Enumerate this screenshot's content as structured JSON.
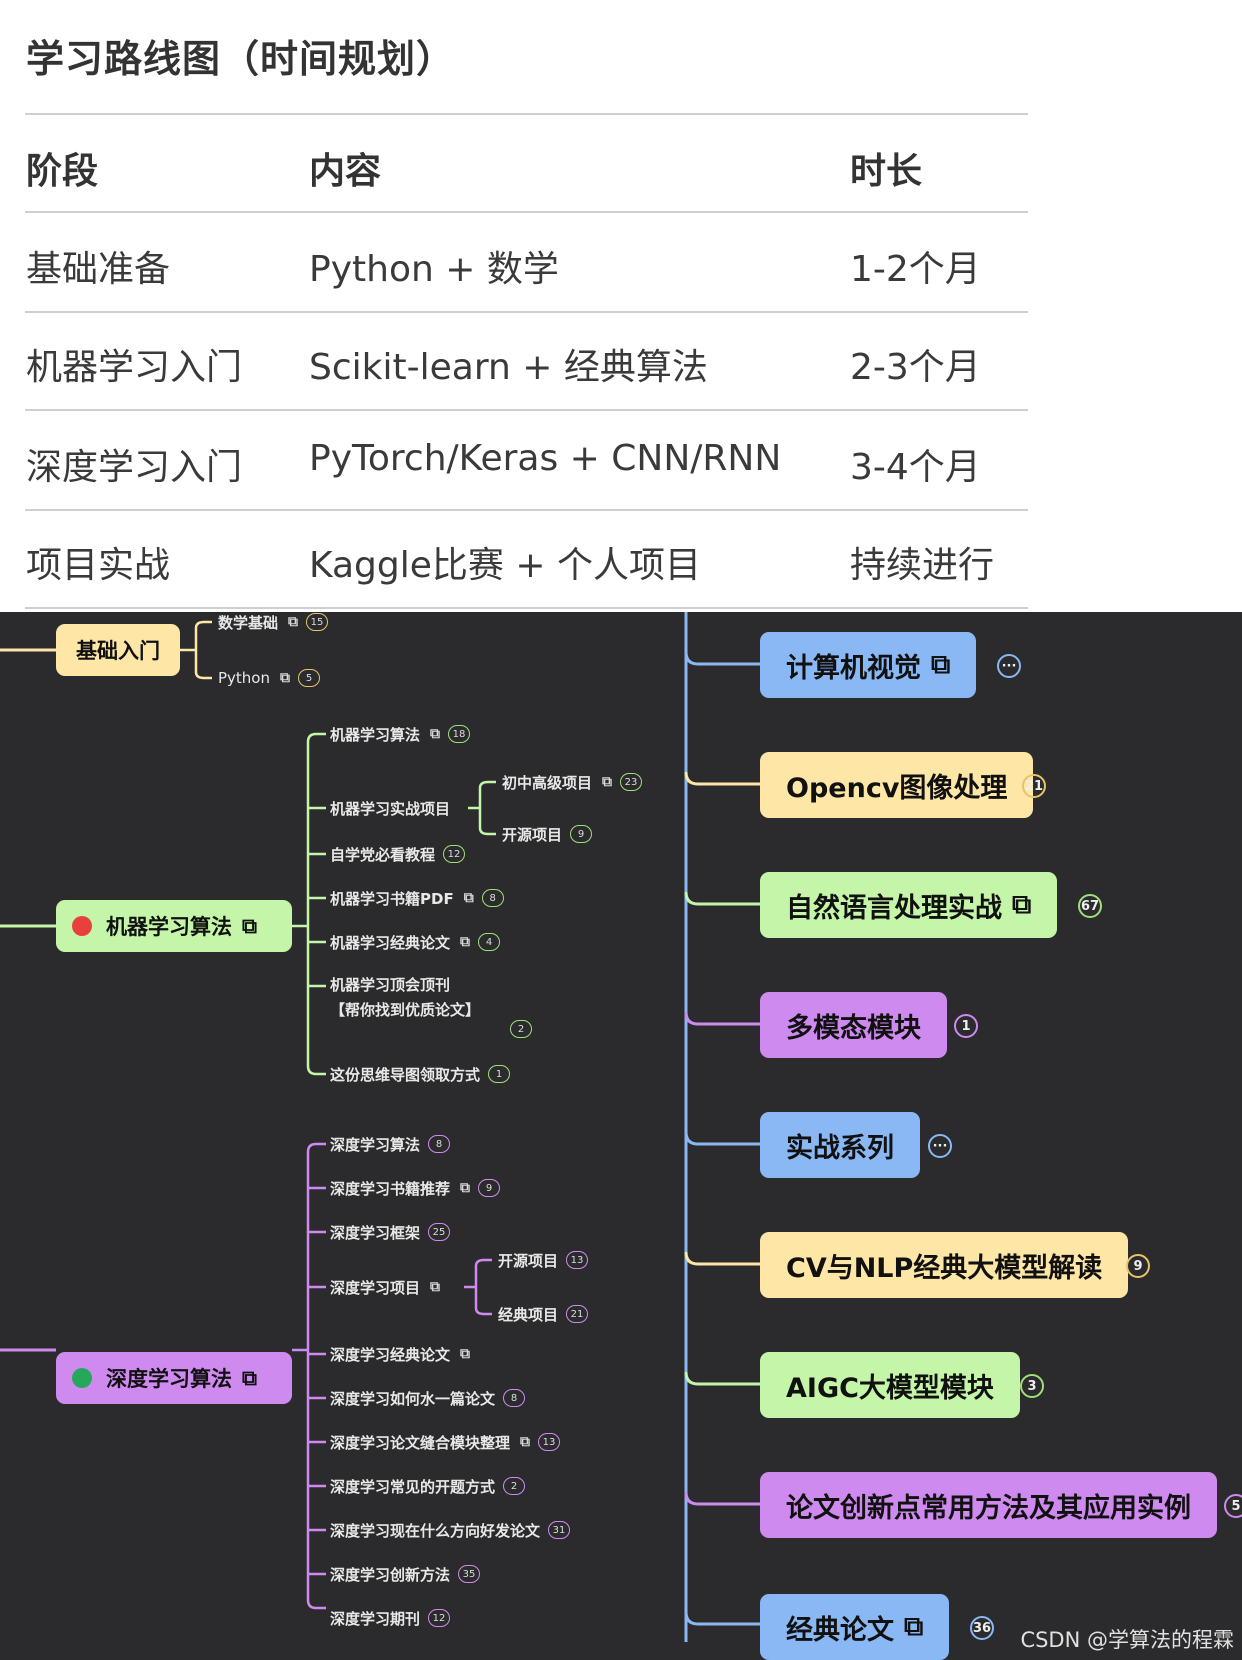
{
  "title": "学习路线图（时间规划）",
  "table": {
    "headers": [
      "阶段",
      "内容",
      "时长"
    ],
    "rows": [
      [
        "基础准备",
        "Python + 数学",
        "1-2个月"
      ],
      [
        "机器学习入门",
        "Scikit-learn + 经典算法",
        "2-3个月"
      ],
      [
        "深度学习入门",
        "PyTorch/Keras + CNN/RNN",
        "3-4个月"
      ],
      [
        "项目实战",
        "Kaggle比赛 + 个人项目",
        "持续进行"
      ]
    ]
  },
  "colors": {
    "yellow": "#fde6a6",
    "green": "#c5f5a8",
    "purple": "#cf8af0",
    "blue": "#8ab8f5",
    "red_dot": "#e8403a",
    "green_dot": "#25a85b"
  },
  "mindmap": {
    "left_nodes": {
      "basics": {
        "label": "基础入门",
        "children": [
          {
            "label": "数学基础",
            "link": true,
            "count": "15"
          },
          {
            "label": "Python",
            "link": true,
            "count": "5"
          }
        ]
      },
      "ml": {
        "label": "机器学习算法",
        "children": [
          {
            "label": "机器学习算法",
            "link": true,
            "count": "18"
          },
          {
            "label": "机器学习实战项目",
            "link": false,
            "count": ""
          },
          {
            "label": "自学党必看教程",
            "link": false,
            "count": "12"
          },
          {
            "label": "机器学习书籍PDF",
            "link": true,
            "count": "8"
          },
          {
            "label": "机器学习经典论文",
            "link": true,
            "count": "4"
          },
          {
            "label": "机器学习顶会顶刊",
            "link": false,
            "count": "2"
          },
          {
            "label": "这份思维导图领取方式",
            "link": false,
            "count": "1"
          }
        ],
        "ml_top_line2": "【帮你找到优质论文】",
        "sub_project": [
          {
            "label": "初中高级项目",
            "link": true,
            "count": "23"
          },
          {
            "label": "开源项目",
            "link": false,
            "count": "9"
          }
        ]
      },
      "dl": {
        "label": "深度学习算法",
        "children": [
          {
            "label": "深度学习算法",
            "link": false,
            "count": "8"
          },
          {
            "label": "深度学习书籍推荐",
            "link": true,
            "count": "9"
          },
          {
            "label": "深度学习框架",
            "link": false,
            "count": "25"
          },
          {
            "label": "深度学习项目",
            "link": true,
            "count": ""
          },
          {
            "label": "深度学习经典论文",
            "link": true,
            "count": ""
          },
          {
            "label": "深度学习如何水一篇论文",
            "link": false,
            "count": "8"
          },
          {
            "label": "深度学习论文缝合模块整理",
            "link": true,
            "count": "13"
          },
          {
            "label": "深度学习常见的开题方式",
            "link": false,
            "count": "2"
          },
          {
            "label": "深度学习现在什么方向好发论文",
            "link": false,
            "count": "31"
          },
          {
            "label": "深度学习创新方法",
            "link": false,
            "count": "35"
          },
          {
            "label": "深度学习期刊",
            "link": false,
            "count": "12"
          }
        ],
        "sub_project": [
          {
            "label": "开源项目",
            "link": false,
            "count": "13"
          },
          {
            "label": "经典项目",
            "link": false,
            "count": "21"
          }
        ]
      }
    },
    "right_nodes": [
      {
        "label": "计算机视觉",
        "link": true,
        "count": "···",
        "color": "blue"
      },
      {
        "label": "Opencv图像处理",
        "link": false,
        "count": "21",
        "color": "yellow"
      },
      {
        "label": "自然语言处理实战",
        "link": true,
        "count": "67",
        "color": "green"
      },
      {
        "label": "多模态模块",
        "link": false,
        "count": "1",
        "color": "purple"
      },
      {
        "label": "实战系列",
        "link": false,
        "count": "···",
        "color": "blue"
      },
      {
        "label": "CV与NLP经典大模型解读",
        "link": false,
        "count": "9",
        "color": "yellow"
      },
      {
        "label": "AIGC大模型模块",
        "link": false,
        "count": "3",
        "color": "green"
      },
      {
        "label": "论文创新点常用方法及其应用实例",
        "link": false,
        "count": "5",
        "color": "purple"
      },
      {
        "label": "经典论文",
        "link": true,
        "count": "36",
        "color": "blue"
      }
    ],
    "link_icon": "external-link-icon"
  },
  "watermark": "CSDN @学算法的程霖"
}
